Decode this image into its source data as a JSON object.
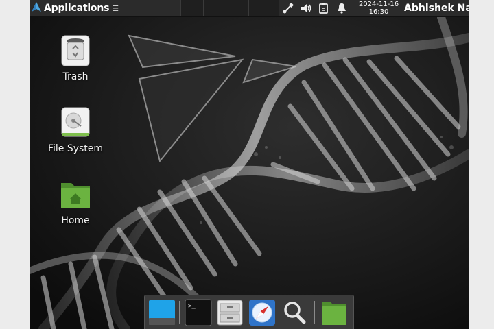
{
  "top_panel": {
    "applications_label": "Applications",
    "applications_menu_glyph": "☰",
    "tray_icons": [
      "network-wired-icon",
      "volume-icon",
      "clipboard-icon",
      "notification-bell-icon"
    ],
    "clock": {
      "date": "2024-11-16",
      "time": "16:30"
    },
    "user_name": "Abhishek Nair"
  },
  "desktop": {
    "icons": [
      {
        "label": "Trash",
        "icon": "trash-icon"
      },
      {
        "label": "File System",
        "icon": "hard-drive-icon"
      },
      {
        "label": "Home",
        "icon": "home-folder-icon"
      }
    ],
    "wallpaper": "dna-double-helix-dark"
  },
  "dock": {
    "items": [
      "show-desktop-icon",
      "terminal-icon",
      "file-manager-icon",
      "web-browser-icon",
      "app-finder-icon",
      "folder-icon"
    ]
  },
  "colors": {
    "panel_bg": "#2b2b2b",
    "desktop_bg": "#151515",
    "folder_green": "#6bb340",
    "show_desktop_blue": "#1fa3e8",
    "dock_bg": "#3a3a3a"
  }
}
